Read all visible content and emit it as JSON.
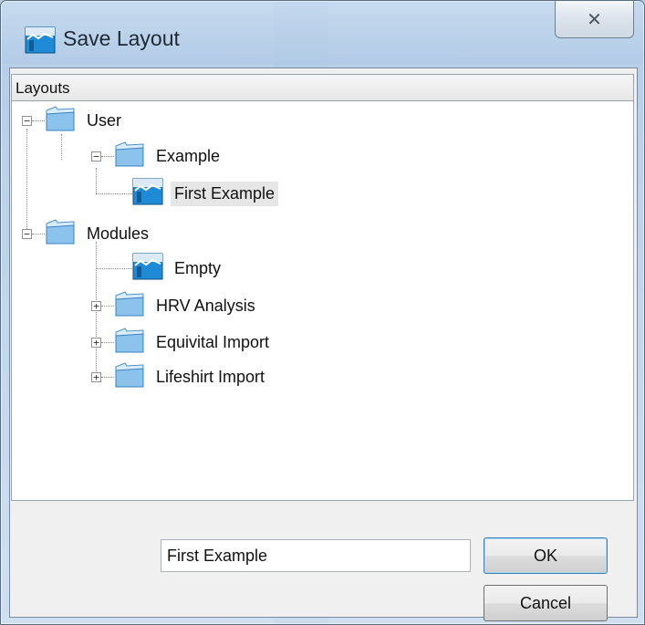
{
  "window": {
    "title": "Save Layout",
    "close_glyph": "✕"
  },
  "panel": {
    "header": "Layouts"
  },
  "tree": {
    "user": "User",
    "example": "Example",
    "first_example": "First Example",
    "modules": "Modules",
    "empty": "Empty",
    "hrv": "HRV Analysis",
    "equivital": "Equivital Import",
    "lifeshirt": "Lifeshirt Import",
    "expanded_glyph": "−",
    "collapsed_glyph": "+"
  },
  "form": {
    "name_value": "First Example",
    "ok_label": "OK",
    "cancel_label": "Cancel"
  },
  "icons": {
    "folder": "folder-icon",
    "layout": "layout-icon"
  },
  "colors": {
    "folder_light": "#d9ecfa",
    "folder_dark": "#4a9ad8",
    "layout_blue": "#1f8ad6",
    "selection": "#e6e6e6"
  }
}
